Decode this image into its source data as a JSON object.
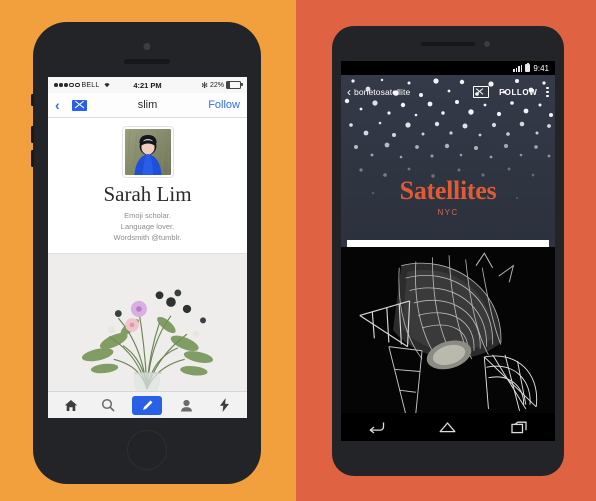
{
  "background": {
    "left_color": "#f2a03d",
    "right_color": "#df6242"
  },
  "ios_phone": {
    "device_name": "iphone-5",
    "body_color": "#222428",
    "status_bar": {
      "carrier": "BELL",
      "signal_dots_filled": 3,
      "signal_dots_hollow": 2,
      "wifi_icon": "wifi-icon",
      "time": "4:21 PM",
      "bluetooth_icon": "bluetooth-icon",
      "bluetooth_glyph": "✻",
      "battery_percent": "22%"
    },
    "nav_bar": {
      "back_label": "‹",
      "mail_icon": "envelope-icon",
      "title": "slim",
      "follow_label": "Follow",
      "accent_color": "#2f6fe8"
    },
    "profile": {
      "avatar_alt": "portrait of person in blue hooded coat",
      "name": "Sarah Lim",
      "bio_line_1": "Emoji scholar.",
      "bio_line_2": "Language lover.",
      "bio_line_3": "Wordsmith @tumblr."
    },
    "post": {
      "image_alt": "wildflower bouquet in glass vase on white background"
    },
    "tab_bar": {
      "items": [
        {
          "name": "home",
          "icon": "home-icon"
        },
        {
          "name": "search",
          "icon": "search-icon"
        },
        {
          "name": "compose",
          "icon": "pencil-icon",
          "accent": "#2860e8"
        },
        {
          "name": "account",
          "icon": "person-icon"
        },
        {
          "name": "activity",
          "icon": "lightning-bolt-icon"
        }
      ]
    }
  },
  "android_phone": {
    "device_name": "android-phone",
    "body_color": "#222428",
    "status_bar": {
      "signal_icon": "signal-bars-icon",
      "battery_icon": "battery-icon",
      "time": "9:41"
    },
    "action_bar": {
      "back_label": "‹",
      "blog_name": "bonetosatellite",
      "mail_icon": "envelope-icon",
      "follow_label": "FOLLOW",
      "overflow_icon": "overflow-menu-icon"
    },
    "header": {
      "title": "Satellites",
      "subtitle": "NYC",
      "title_color": "#e05a36",
      "background_color": "#2f3440",
      "background_alt": "starfield"
    },
    "post": {
      "image_alt": "black and white photo of a radio telescope dish"
    },
    "nav_bar": {
      "items": [
        {
          "name": "back",
          "icon": "back-arrow-icon"
        },
        {
          "name": "home",
          "icon": "home-outline-icon"
        },
        {
          "name": "recents",
          "icon": "recents-squares-icon"
        }
      ]
    }
  }
}
